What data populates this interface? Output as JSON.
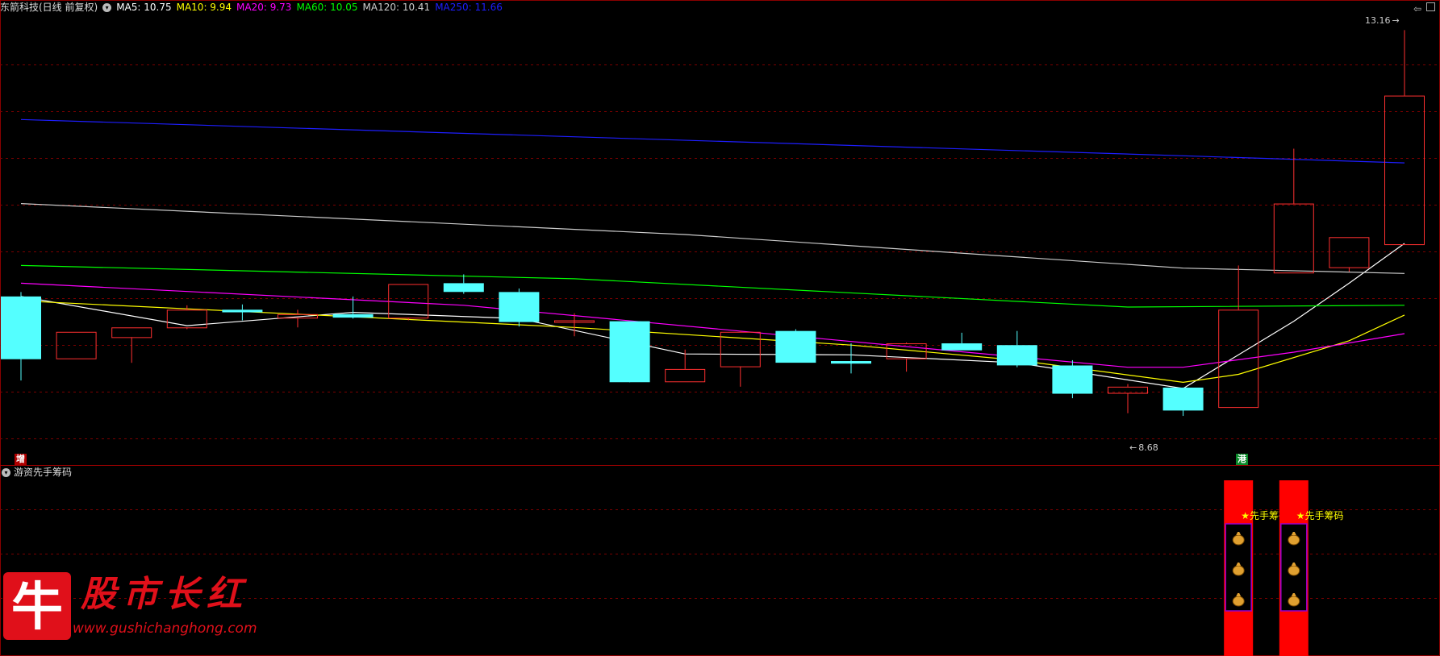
{
  "header": {
    "stock_title": "东箭科技(日线 前复权)",
    "ma_labels": [
      {
        "text": "MA5: 10.75",
        "color": "#ffffff"
      },
      {
        "text": "MA10: 9.94",
        "color": "#ffff00"
      },
      {
        "text": "MA20: 9.73",
        "color": "#ff00ff"
      },
      {
        "text": "MA60: 10.05",
        "color": "#00ff00"
      },
      {
        "text": "MA120: 10.41",
        "color": "#cccccc"
      },
      {
        "text": "MA250: 11.66",
        "color": "#1e1eff"
      }
    ]
  },
  "sub_panel": {
    "title": "游资先手筹码",
    "signal_label": "★先手筹码",
    "signal_icon": "money-bag-icon"
  },
  "markers": {
    "max_label": "13.16",
    "min_label": "8.68",
    "tag_left": "增",
    "tag_right": "港"
  },
  "logo": {
    "char": "牛",
    "title": "股市长红",
    "url": "www.gushichanghong.com"
  },
  "colors": {
    "up": "#ff3030",
    "down": "#54ffff",
    "grid": "#7a0000",
    "signal_red": "#ff0000",
    "signal_box": "#9900cc",
    "signal_text": "#ffff00"
  },
  "chart_data": {
    "type": "candlestick",
    "ylim": [
      8.4,
      13.3
    ],
    "candles": [
      {
        "o": 10.15,
        "h": 10.2,
        "l": 9.2,
        "c": 9.45
      },
      {
        "o": 9.45,
        "h": 9.75,
        "l": 9.45,
        "c": 9.75
      },
      {
        "o": 9.69,
        "h": 9.8,
        "l": 9.4,
        "c": 9.8
      },
      {
        "o": 9.8,
        "h": 10.05,
        "l": 9.78,
        "c": 10.0
      },
      {
        "o": 10.0,
        "h": 10.06,
        "l": 9.88,
        "c": 9.98
      },
      {
        "o": 9.91,
        "h": 10.0,
        "l": 9.8,
        "c": 9.95
      },
      {
        "o": 9.95,
        "h": 10.15,
        "l": 9.9,
        "c": 9.92
      },
      {
        "o": 9.91,
        "h": 10.29,
        "l": 9.88,
        "c": 10.29
      },
      {
        "o": 10.3,
        "h": 10.4,
        "l": 10.18,
        "c": 10.21
      },
      {
        "o": 10.2,
        "h": 10.24,
        "l": 9.81,
        "c": 9.87
      },
      {
        "o": 9.88,
        "h": 9.96,
        "l": 9.7,
        "c": 9.88
      },
      {
        "o": 9.87,
        "h": 9.87,
        "l": 9.18,
        "c": 9.19
      },
      {
        "o": 9.19,
        "h": 9.55,
        "l": 9.19,
        "c": 9.33
      },
      {
        "o": 9.36,
        "h": 9.76,
        "l": 9.13,
        "c": 9.75
      },
      {
        "o": 9.76,
        "h": 9.78,
        "l": 9.41,
        "c": 9.41
      },
      {
        "o": 9.42,
        "h": 9.62,
        "l": 9.28,
        "c": 9.4
      },
      {
        "o": 9.45,
        "h": 9.63,
        "l": 9.3,
        "c": 9.62
      },
      {
        "o": 9.62,
        "h": 9.74,
        "l": 9.55,
        "c": 9.55
      },
      {
        "o": 9.6,
        "h": 9.76,
        "l": 9.35,
        "c": 9.38
      },
      {
        "o": 9.37,
        "h": 9.43,
        "l": 9.0,
        "c": 9.06
      },
      {
        "o": 9.06,
        "h": 9.16,
        "l": 8.83,
        "c": 9.13
      },
      {
        "o": 9.12,
        "h": 9.12,
        "l": 8.8,
        "c": 8.87
      },
      {
        "o": 8.9,
        "h": 10.5,
        "l": 8.9,
        "c": 10.0
      },
      {
        "o": 10.42,
        "h": 11.82,
        "l": 10.42,
        "c": 11.2
      },
      {
        "o": 10.48,
        "h": 10.82,
        "l": 10.43,
        "c": 10.82
      },
      {
        "o": 10.74,
        "h": 13.16,
        "l": 10.74,
        "c": 12.42
      }
    ],
    "ma_series": [
      {
        "key": "MA5",
        "x": [
          0,
          3,
          6,
          9,
          12,
          15,
          18,
          21,
          23,
          24,
          25
        ],
        "values": [
          10.15,
          9.82,
          9.97,
          9.9,
          9.5,
          9.49,
          9.4,
          9.11,
          9.87,
          10.3,
          10.75
        ]
      },
      {
        "key": "MA10",
        "x": [
          0,
          5,
          10,
          15,
          18,
          21,
          22,
          24,
          25
        ],
        "values": [
          10.1,
          9.95,
          9.8,
          9.6,
          9.43,
          9.18,
          9.27,
          9.65,
          9.94
        ]
      },
      {
        "key": "MA20",
        "x": [
          0,
          8,
          14,
          20,
          21,
          23,
          25
        ],
        "values": [
          10.3,
          10.05,
          9.7,
          9.35,
          9.35,
          9.52,
          9.73
        ]
      },
      {
        "key": "MA60",
        "x": [
          0,
          10,
          20,
          25
        ],
        "values": [
          10.5,
          10.35,
          10.03,
          10.05
        ]
      },
      {
        "key": "MA120",
        "x": [
          0,
          12,
          21,
          25
        ],
        "values": [
          11.2,
          10.85,
          10.47,
          10.41
        ]
      },
      {
        "key": "MA250",
        "x": [
          0,
          21,
          25
        ],
        "values": [
          12.15,
          11.74,
          11.66
        ]
      }
    ],
    "signals": [
      {
        "candle": 22,
        "bags": 3
      },
      {
        "candle": 23,
        "bags": 3
      }
    ]
  }
}
